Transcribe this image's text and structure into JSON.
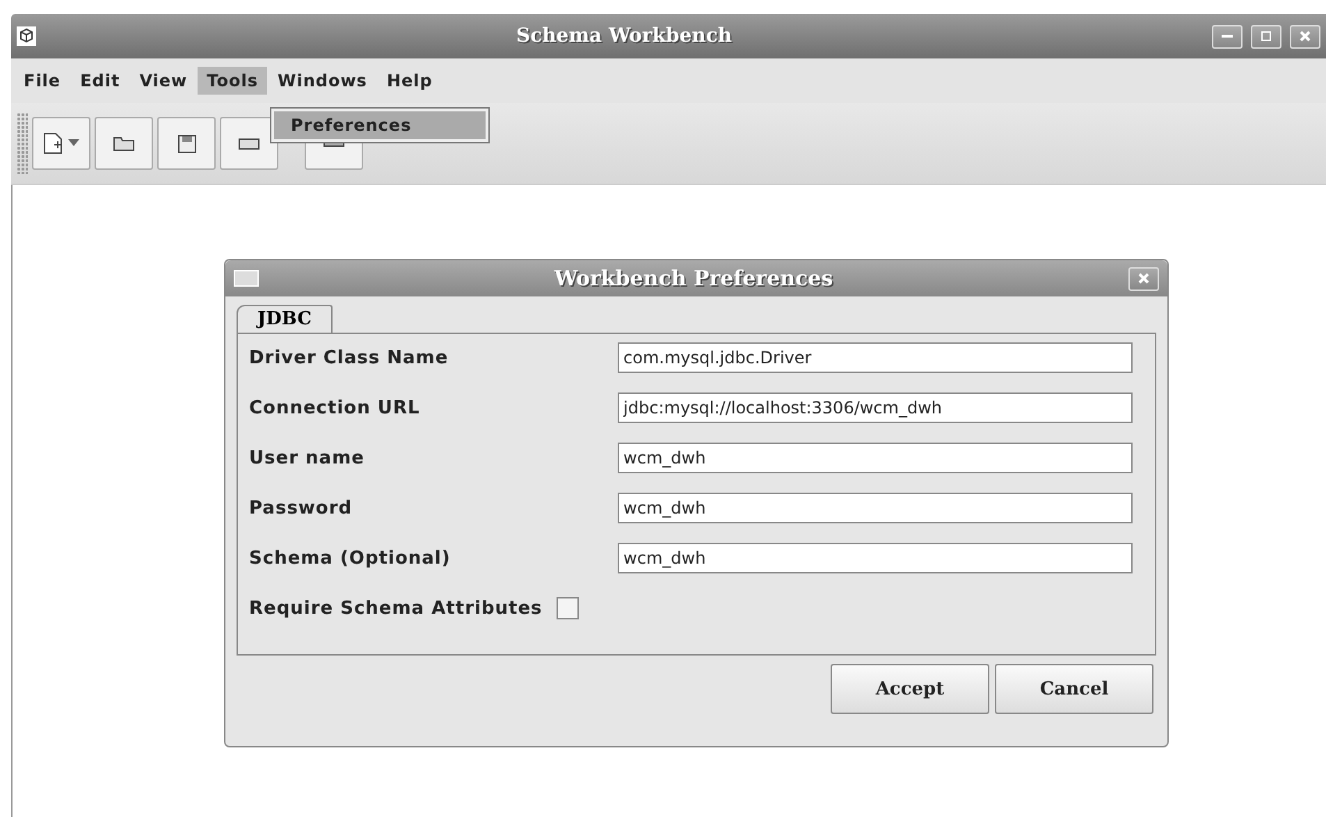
{
  "window": {
    "title": "Schema Workbench"
  },
  "menu": [
    {
      "label": "File",
      "selected": false
    },
    {
      "label": "Edit",
      "selected": false
    },
    {
      "label": "View",
      "selected": false
    },
    {
      "label": "Tools",
      "selected": true
    },
    {
      "label": "Windows",
      "selected": false
    },
    {
      "label": "Help",
      "selected": false
    }
  ],
  "dropdown": {
    "items": [
      "Preferences"
    ]
  },
  "dialog": {
    "title": "Workbench Preferences",
    "tabs": [
      {
        "label": "JDBC",
        "selected": true
      }
    ],
    "fields": [
      {
        "kind": "text",
        "label": "Driver Class Name",
        "value": "com.mysql.jdbc.Driver"
      },
      {
        "kind": "text",
        "label": "Connection URL",
        "value": "jdbc:mysql://localhost:3306/wcm_dwh"
      },
      {
        "kind": "text",
        "label": "User name",
        "value": "wcm_dwh"
      },
      {
        "kind": "text",
        "label": "Password",
        "value": "wcm_dwh"
      },
      {
        "kind": "text",
        "label": "Schema (Optional)",
        "value": "wcm_dwh"
      },
      {
        "kind": "checkbox",
        "label": "Require Schema Attributes",
        "checked": false
      }
    ],
    "buttons": [
      "Accept",
      "Cancel"
    ]
  }
}
